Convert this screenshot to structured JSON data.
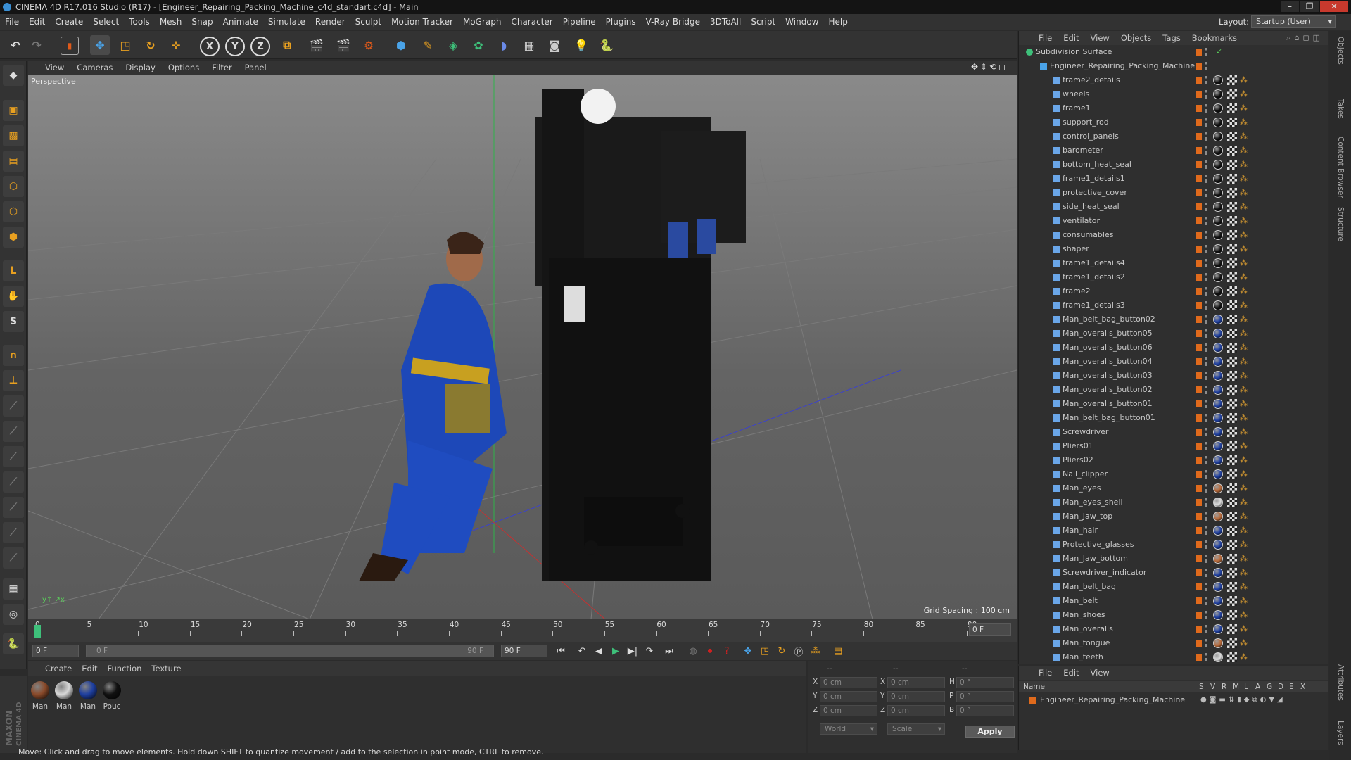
{
  "window": {
    "title": "CINEMA 4D R17.016 Studio (R17) - [Engineer_Repairing_Packing_Machine_c4d_standart.c4d] - Main"
  },
  "menu": [
    "File",
    "Edit",
    "Create",
    "Select",
    "Tools",
    "Mesh",
    "Snap",
    "Animate",
    "Simulate",
    "Render",
    "Sculpt",
    "Motion Tracker",
    "MoGraph",
    "Character",
    "Pipeline",
    "Plugins",
    "V-Ray Bridge",
    "3DToAll",
    "Script",
    "Window",
    "Help"
  ],
  "layout": {
    "label": "Layout:",
    "value": "Startup (User)"
  },
  "viewport": {
    "menu": [
      "View",
      "Cameras",
      "Display",
      "Options",
      "Filter",
      "Panel"
    ],
    "label": "Perspective",
    "grid_spacing": "Grid Spacing : 100 cm"
  },
  "timeline": {
    "ticks": [
      "0",
      "5",
      "10",
      "15",
      "20",
      "25",
      "30",
      "35",
      "40",
      "45",
      "50",
      "55",
      "60",
      "65",
      "70",
      "75",
      "80",
      "85",
      "90"
    ],
    "frame_end_field": "0 F",
    "start_field": "0 F",
    "range_start": "0 F",
    "range_end": "90 F",
    "end_field": "90 F"
  },
  "materials": {
    "menu": [
      "Create",
      "Edit",
      "Function",
      "Texture"
    ],
    "items": [
      {
        "label": "Man",
        "color": "#8a4a2a"
      },
      {
        "label": "Man",
        "color": "#d8d8d8"
      },
      {
        "label": "Man",
        "color": "#1e3fa0"
      },
      {
        "label": "Pouc",
        "color": "#111111"
      }
    ]
  },
  "coords": {
    "header": [
      "--",
      "--",
      "--"
    ],
    "rows": [
      {
        "a": "X",
        "av": "0 cm",
        "b": "X",
        "bv": "0 cm",
        "c": "H",
        "cv": "0 °"
      },
      {
        "a": "Y",
        "av": "0 cm",
        "b": "Y",
        "bv": "0 cm",
        "c": "P",
        "cv": "0 °"
      },
      {
        "a": "Z",
        "av": "0 cm",
        "b": "Z",
        "bv": "0 cm",
        "c": "B",
        "cv": "0 °"
      }
    ],
    "world": "World",
    "scale": "Scale",
    "apply": "Apply"
  },
  "objects": {
    "menu": [
      "File",
      "Edit",
      "View",
      "Objects",
      "Tags",
      "Bookmarks"
    ],
    "root": "Subdivision Surface",
    "group": "Engineer_Repairing_Packing_Machine",
    "items": [
      "frame2_details",
      "wheels",
      "frame1",
      "support_rod",
      "control_panels",
      "barometer",
      "bottom_heat_seal",
      "frame1_details1",
      "protective_cover",
      "side_heat_seal",
      "ventilator",
      "consumables",
      "shaper",
      "frame1_details4",
      "frame1_details2",
      "frame2",
      "frame1_details3",
      "Man_belt_bag_button02",
      "Man_overalls_button05",
      "Man_overalls_button06",
      "Man_overalls_button04",
      "Man_overalls_button03",
      "Man_overalls_button02",
      "Man_overalls_button01",
      "Man_belt_bag_button01",
      "Screwdriver",
      "Pliers01",
      "Pliers02",
      "Nail_clipper",
      "Man_eyes",
      "Man_eyes_shell",
      "Man_Jaw_top",
      "Man_hair",
      "Protective_glasses",
      "Man_Jaw_bottom",
      "Screwdriver_indicator",
      "Man_belt_bag",
      "Man_belt",
      "Man_shoes",
      "Man_overalls",
      "Man_tongue",
      "Man_teeth"
    ],
    "tag_colors": [
      "#111111",
      "#111111",
      "#111111",
      "#111111",
      "#111111",
      "#111111",
      "#111111",
      "#111111",
      "#111111",
      "#111111",
      "#111111",
      "#111111",
      "#111111",
      "#111111",
      "#111111",
      "#111111",
      "#111111",
      "#1e3fa0",
      "#1e3fa0",
      "#1e3fa0",
      "#1e3fa0",
      "#1e3fa0",
      "#1e3fa0",
      "#1e3fa0",
      "#1e3fa0",
      "#1e3fa0",
      "#1e3fa0",
      "#1e3fa0",
      "#1e3fa0",
      "#b86a3a",
      "#dddddd",
      "#b86a3a",
      "#1e3fa0",
      "#1e3fa0",
      "#b86a3a",
      "#1e3fa0",
      "#1e3fa0",
      "#1e3fa0",
      "#1e3fa0",
      "#1e3fa0",
      "#b86a3a",
      "#dddddd"
    ]
  },
  "layers": {
    "menu": [
      "File",
      "Edit",
      "View"
    ],
    "name_header": "Name",
    "cols": [
      "S",
      "V",
      "R",
      "M",
      "L",
      "A",
      "G",
      "D",
      "E",
      "X"
    ],
    "row": "Engineer_Repairing_Packing_Machine"
  },
  "right_tabs": [
    "Objects",
    "Takes",
    "Content Browser",
    "Structure",
    "Attributes",
    "Layers"
  ],
  "status": "Move: Click and drag to move elements. Hold down SHIFT to quantize movement / add to the selection in point mode, CTRL to remove.",
  "brand": {
    "maxon": "MAXON",
    "c4d": "CINEMA 4D"
  }
}
